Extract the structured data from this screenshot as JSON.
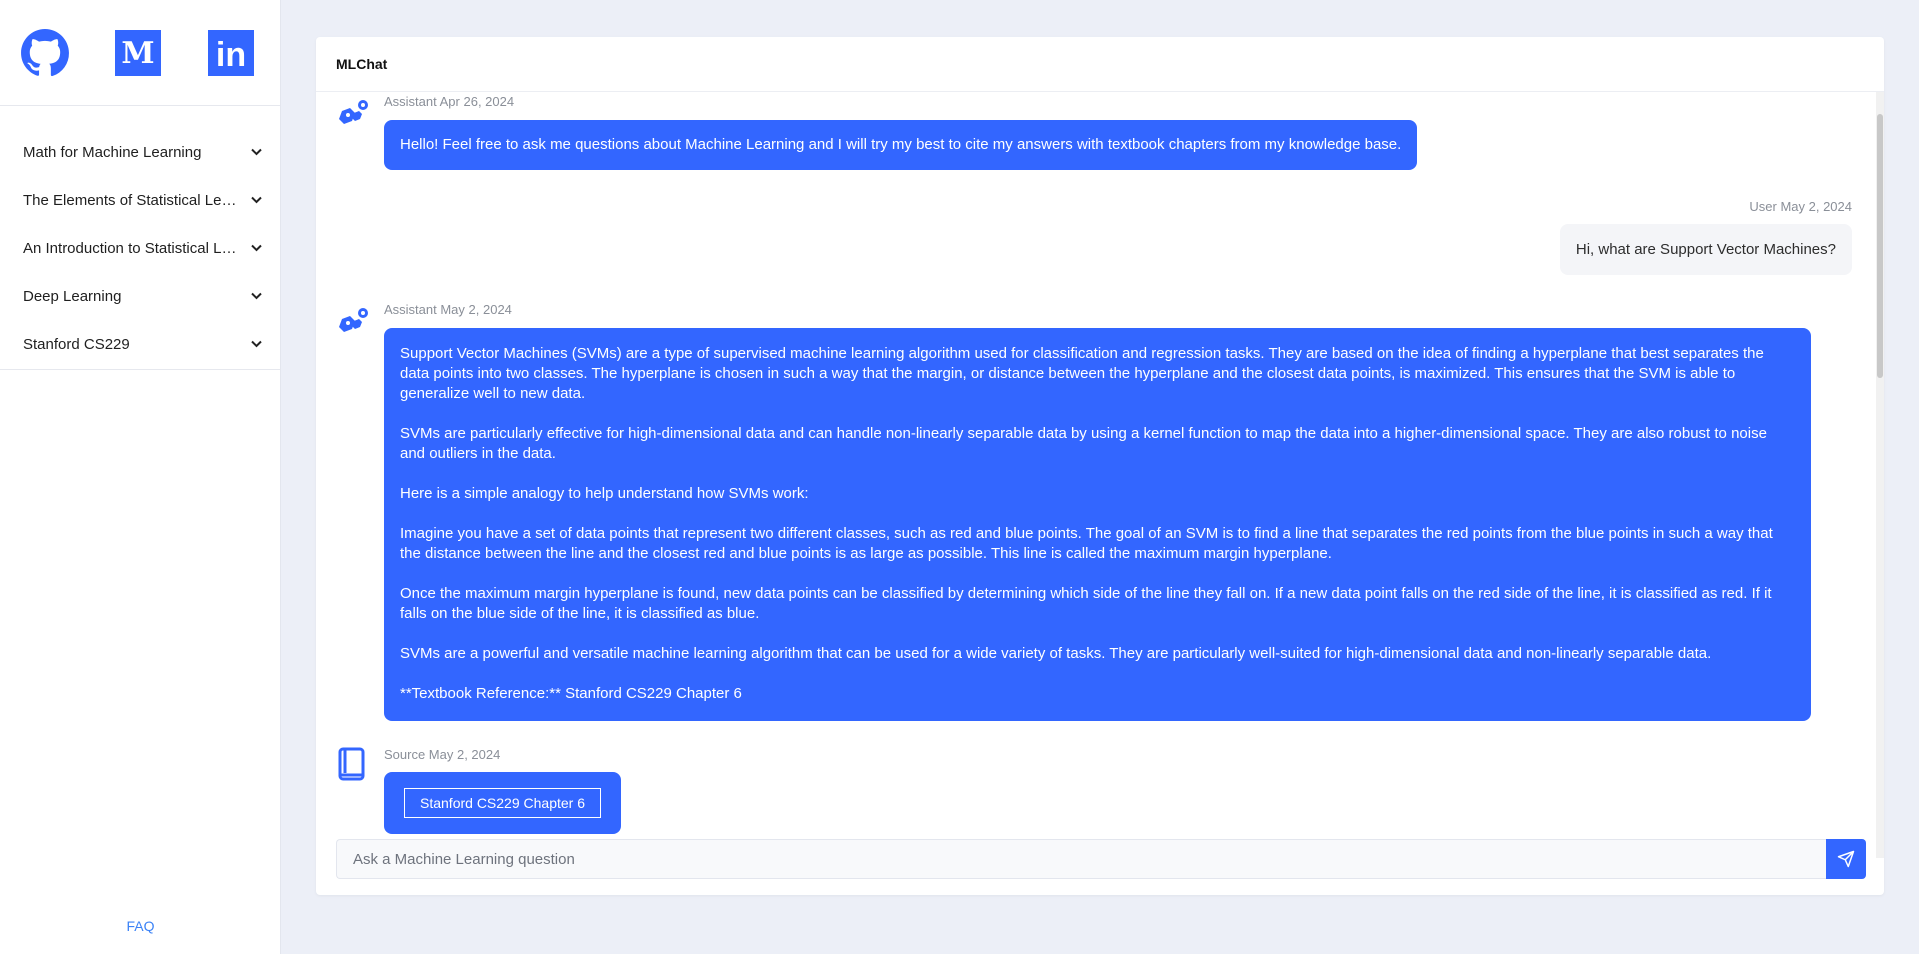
{
  "app": {
    "title": "MLChat"
  },
  "social": [
    {
      "name": "github-icon"
    },
    {
      "name": "medium-icon",
      "glyph": "M"
    },
    {
      "name": "linkedin-icon",
      "glyph": "in"
    }
  ],
  "sidebar": {
    "items": [
      {
        "label": "Math for Machine Learning"
      },
      {
        "label": "The Elements of Statistical Learning"
      },
      {
        "label": "An Introduction to Statistical Learning"
      },
      {
        "label": "Deep Learning"
      },
      {
        "label": "Stanford CS229"
      }
    ],
    "faq": "FAQ"
  },
  "messages": [
    {
      "meta": "Assistant Apr 26, 2024",
      "text": "Hello! Feel free to ask me questions about Machine Learning and I will try my best to cite my answers with textbook chapters from my knowledge base."
    },
    {
      "meta": "User May 2, 2024",
      "text": "Hi, what are Support Vector Machines?"
    },
    {
      "meta": "Assistant May 2, 2024",
      "paragraphs": [
        "Support Vector Machines (SVMs) are a type of supervised machine learning algorithm used for classification and regression tasks. They are based on the idea of finding a hyperplane that best separates the data points into two classes. The hyperplane is chosen in such a way that the margin, or distance between the hyperplane and the closest data points, is maximized. This ensures that the SVM is able to generalize well to new data.",
        "SVMs are particularly effective for high-dimensional data and can handle non-linearly separable data by using a kernel function to map the data into a higher-dimensional space. They are also robust to noise and outliers in the data.",
        "Here is a simple analogy to help understand how SVMs work:",
        "Imagine you have a set of data points that represent two different classes, such as red and blue points. The goal of an SVM is to find a line that separates the red points from the blue points in such a way that the distance between the line and the closest red and blue points is as large as possible. This line is called the maximum margin hyperplane.",
        "Once the maximum margin hyperplane is found, new data points can be classified by determining which side of the line they fall on. If a new data point falls on the red side of the line, it is classified as red. If it falls on the blue side of the line, it is classified as blue.",
        "SVMs are a powerful and versatile machine learning algorithm that can be used for a wide variety of tasks. They are particularly well-suited for high-dimensional data and non-linearly separable data.",
        "**Textbook Reference:** Stanford CS229 Chapter 6"
      ]
    },
    {
      "meta": "Source May 2, 2024",
      "button": "Stanford CS229 Chapter 6"
    }
  ],
  "input": {
    "placeholder": "Ask a Machine Learning question"
  },
  "colors": {
    "accent": "#3366ff",
    "background": "#eceff7"
  }
}
